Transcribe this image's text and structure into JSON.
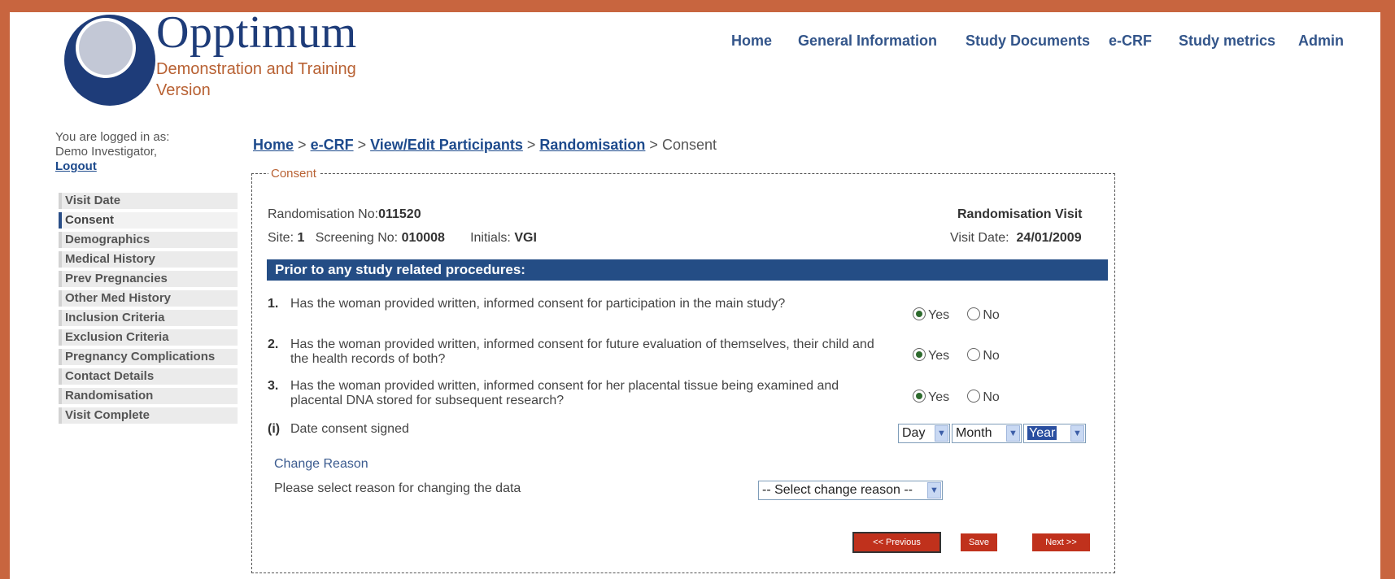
{
  "brand": {
    "name": "Opptimum",
    "subtitle_line1": "Demonstration and Training",
    "subtitle_line2": "Version"
  },
  "nav": [
    "Home",
    "General Information",
    "Study Documents",
    "e-CRF",
    "Study metrics",
    "Admin"
  ],
  "login": {
    "line1": "You are logged in as:",
    "line2": "Demo Investigator,",
    "logout": "Logout"
  },
  "sidebar": {
    "items": [
      {
        "label": "Visit Date"
      },
      {
        "label": "Consent"
      },
      {
        "label": "Demographics"
      },
      {
        "label": "Medical History"
      },
      {
        "label": "Prev Pregnancies"
      },
      {
        "label": "Other Med History"
      },
      {
        "label": "Inclusion Criteria"
      },
      {
        "label": "Exclusion Criteria"
      },
      {
        "label": "Pregnancy Complications"
      },
      {
        "label": "Contact Details"
      },
      {
        "label": "Randomisation"
      },
      {
        "label": "Visit Complete"
      }
    ],
    "active": "Consent"
  },
  "breadcrumb": {
    "items": [
      "Home",
      "e-CRF",
      "View/Edit Participants",
      "Randomisation"
    ],
    "separator": ">",
    "current": "Consent"
  },
  "form": {
    "legend": "Consent",
    "randomisation_label": "Randomisation No:",
    "randomisation_no": "011520",
    "visit_title": "Randomisation Visit",
    "site_label": "Site:",
    "site_value": "1",
    "screening_label": "Screening No:",
    "screening_value": "010008",
    "initials_label": "Initials:",
    "initials_value": "VGI",
    "visit_date_label": "Visit Date:",
    "visit_date_value": "24/01/2009",
    "section_title": "Prior to any study related procedures:",
    "questions": [
      {
        "num": "1.",
        "text": "Has the woman provided written, informed consent for participation in the main study?",
        "answer": "Yes"
      },
      {
        "num": "2.",
        "text": "Has the woman provided written, informed consent for future evaluation of themselves, their child and the health records of both?",
        "answer": "Yes"
      },
      {
        "num": "3.",
        "text": "Has the woman provided written, informed consent for her placental tissue being examined and placental DNA stored for subsequent research?",
        "answer": "Yes"
      }
    ],
    "yes_label": "Yes",
    "no_label": "No",
    "date_consent": {
      "num": "(i)",
      "label": "Date consent signed",
      "day": "Day",
      "month": "Month",
      "year": "Year"
    },
    "change_reason_title": "Change Reason",
    "change_reason_prompt": "Please select reason for changing the data",
    "change_reason_select": "-- Select change reason --",
    "buttons": {
      "previous": "<< Previous",
      "save": "Save",
      "next": "Next >>"
    }
  },
  "colors": {
    "accent": "#244d85",
    "brand_orange": "#c8653f",
    "button_red": "#c0311c"
  }
}
